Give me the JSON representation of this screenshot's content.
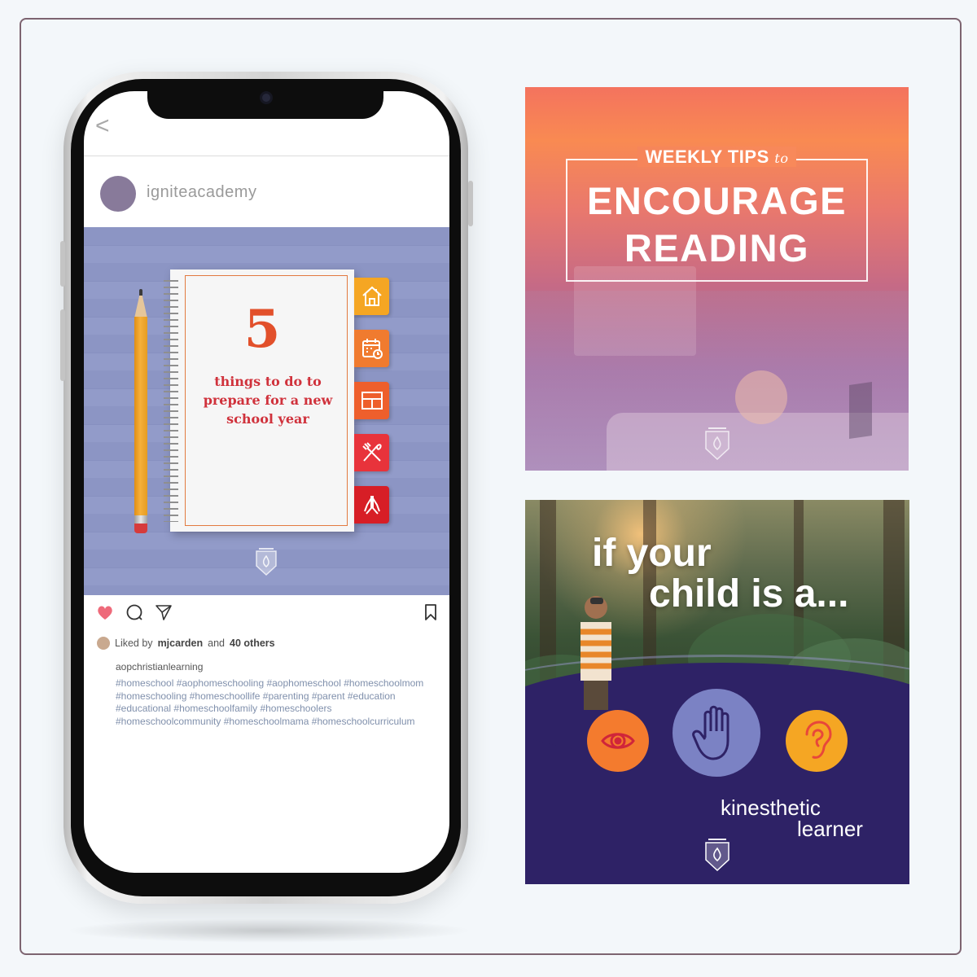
{
  "phone": {
    "back_icon": "<",
    "username": "igniteacademy",
    "post": {
      "number": "5",
      "title": "things to do to prepare for a new school year",
      "tabs": [
        "home-icon",
        "calendar-icon",
        "layout-icon",
        "utensils-icon",
        "praying-hands-icon"
      ],
      "tab_colors": [
        "#f5a623",
        "#f07b2f",
        "#ee5f2c",
        "#e8333b",
        "#d71e26"
      ]
    },
    "likes": {
      "prefix": "Liked by",
      "user": "mjcarden",
      "middle": "and",
      "count": "40 others"
    },
    "caption_user": "aopchristianlearning",
    "hashtags": "#homeschool #aophomeschooling #aophomeschool #homeschoolmom #homeschooling #homeschoollife #parenting #parent #education #educational #homeschoolfamily #homeschoolers #homeschoolcommunity #homeschoolmama #homeschoolcurriculum"
  },
  "card1": {
    "weekly": "WEEKLY TIPS",
    "to": "to",
    "line1": "ENCOURAGE",
    "line2": "READING"
  },
  "card2": {
    "line1": "if your",
    "line2": "child is a...",
    "circles": [
      {
        "icon": "eye-icon",
        "color": "#f47b2e"
      },
      {
        "icon": "hand-icon",
        "color": "#7b82c4"
      },
      {
        "icon": "ear-icon",
        "color": "#f5a623"
      }
    ],
    "label1": "kinesthetic",
    "label2": "learner"
  }
}
